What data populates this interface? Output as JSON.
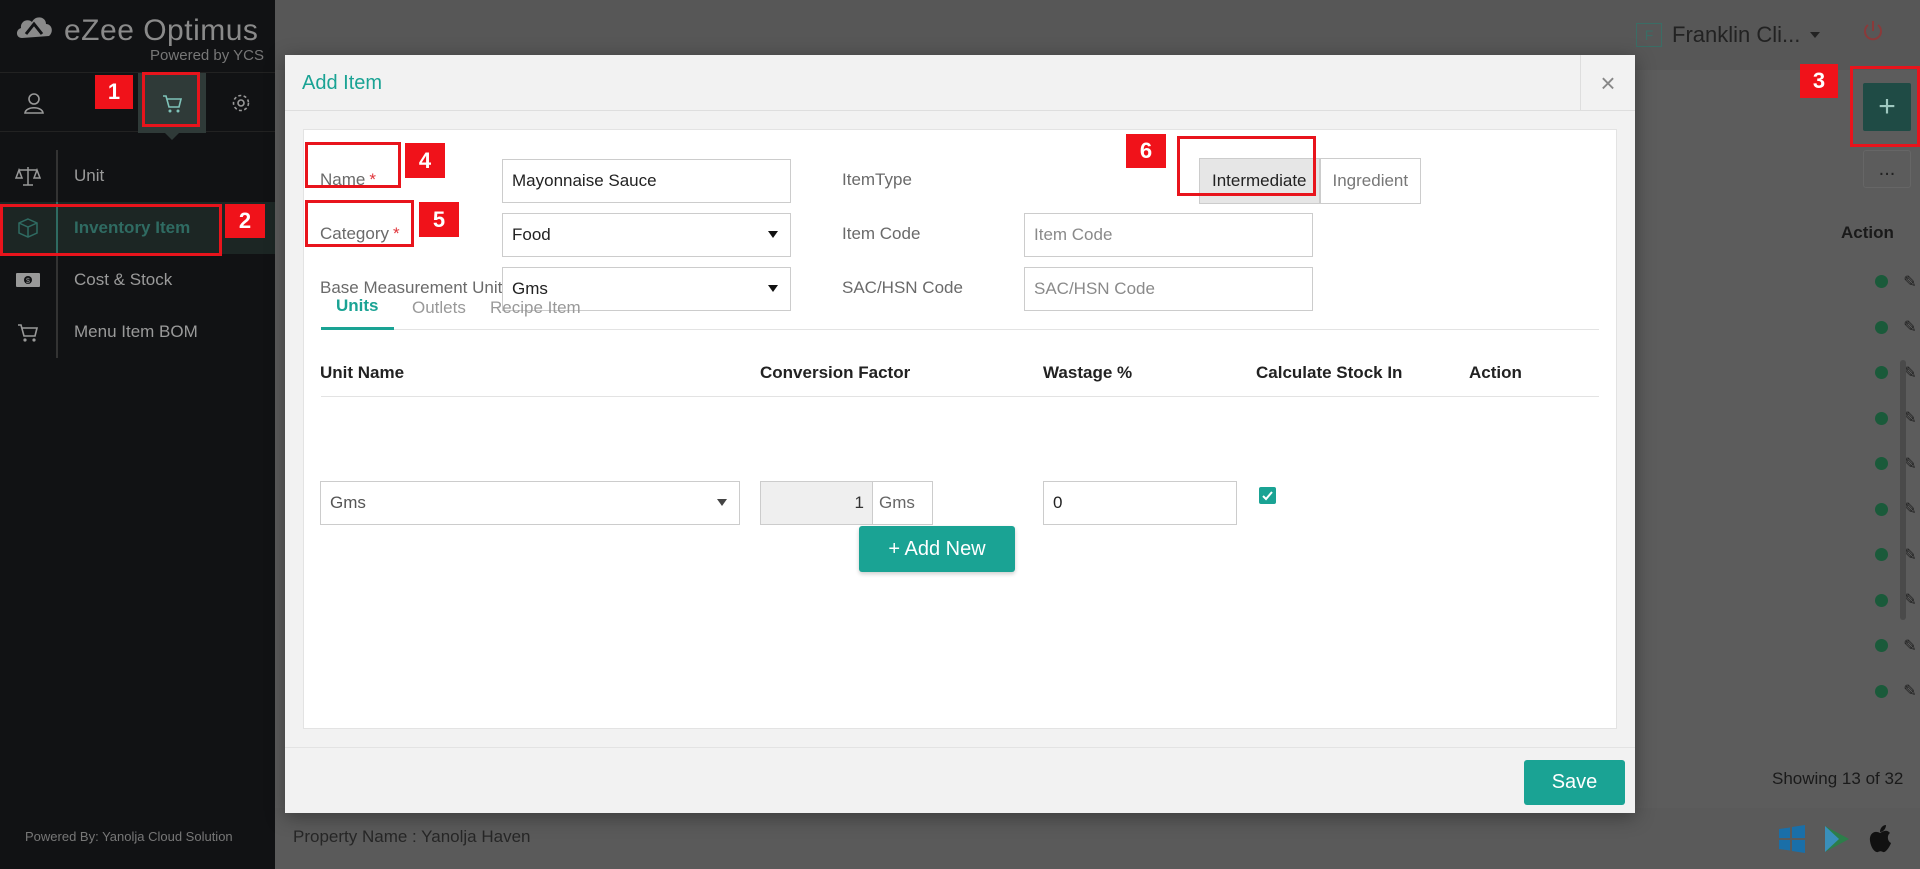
{
  "sidebar": {
    "logo_title": "eZee Optimus",
    "logo_subtitle": "Powered by YCS",
    "top_icons": [
      "user-icon",
      "cart-icon",
      "gear-icon"
    ],
    "menu": [
      {
        "label": "Unit",
        "icon": "scale-icon"
      },
      {
        "label": "Inventory Item",
        "icon": "box-icon"
      },
      {
        "label": "Cost & Stock",
        "icon": "money-icon"
      },
      {
        "label": "Menu Item BOM",
        "icon": "cart-icon"
      }
    ],
    "footer": "Powered By: Yanolja Cloud Solution"
  },
  "header": {
    "user_initial": "F",
    "user_name": "Franklin Cli..."
  },
  "background_page": {
    "action_header": "Action",
    "row_count": 10,
    "showing_text": "Showing 13 of 32",
    "property": "Property Name : Yanolja Haven",
    "more_label": "..."
  },
  "modal": {
    "title": "Add Item",
    "close_label": "×",
    "form": {
      "name_label": "Name",
      "name_value": "Mayonnaise Sauce",
      "category_label": "Category",
      "category_value": "Food",
      "base_unit_label": "Base Measurement Unit",
      "base_unit_value": "Gms",
      "required_mark": "*",
      "item_type_label": "ItemType",
      "item_type_options": [
        "Intermediate",
        "Ingredient"
      ],
      "item_code_label": "Item Code",
      "item_code_placeholder": "Item Code",
      "sac_label": "SAC/HSN Code",
      "sac_placeholder": "SAC/HSN Code"
    },
    "tabs": [
      "Units",
      "Outlets",
      "Recipe Item"
    ],
    "active_tab": "Units",
    "table": {
      "headers": [
        "Unit Name",
        "Conversion Factor",
        "Wastage %",
        "Calculate Stock In",
        "Action"
      ],
      "row": {
        "unit_name": "Gms",
        "conversion_value": "1",
        "conversion_unit": "Gms",
        "wastage": "0",
        "calculate_stock_in": true
      }
    },
    "add_new_label": "+ Add New",
    "save_label": "Save"
  },
  "annotations": [
    "1",
    "2",
    "3",
    "4",
    "5",
    "6"
  ],
  "colors": {
    "accent": "#1aa394",
    "annotation": "#e8141c",
    "sidebar_bg": "#111214"
  }
}
